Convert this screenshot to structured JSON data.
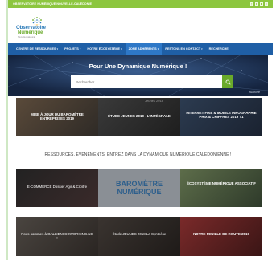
{
  "topbar": {
    "brand": "OBSERVATOIRE NUMÉRIQUE NOUVELLE-CALÉDONIE",
    "social": [
      "facebook-icon",
      "twitter-icon",
      "linkedin-icon",
      "youtube-icon"
    ]
  },
  "logo": {
    "line1": "Observatoire",
    "line2": "Numérique",
    "line3": "Nouvelle-Calédonie"
  },
  "nav": [
    {
      "label": "CENTRE DE RESSOURCES",
      "caret": true
    },
    {
      "label": "PROJETS",
      "caret": true
    },
    {
      "label": "NOTRE ÉCOSYSTÈME",
      "caret": true
    },
    {
      "label": "ZONE ADHÉRENTS",
      "caret": true,
      "active": true
    },
    {
      "label": "RESTONS EN CONTACT",
      "caret": true
    },
    {
      "label": "RECHERCHE",
      "caret": false
    }
  ],
  "hero": {
    "title": "Pour Une Dynamique Numérique !",
    "search_placeholder": "Rechercher",
    "advanced": "Avancée"
  },
  "row1": [
    {
      "label": "MISE À JOUR DU BAROMÈTRE ENTREPRISES 2019"
    },
    {
      "label": "ÉTUDE JEUNES 2018 - L'INTÉGRALE"
    },
    {
      "label": "INTERNET FIXE & MOBILE INFOGRAPHIE PRIX & CHIFFRES 2019 T1"
    }
  ],
  "row1_caption": "Jeunes 2018",
  "section_title": "RESSOURCES, ÉVÉNEMENTS, ENTREZ DANS LA DYNAMIQUE NUMÉRIQUE CALÉDONIENNE !",
  "row2": [
    {
      "label": "E-COMMERCE Dossier Agir & Croître"
    },
    {
      "label": "BAROMÈTRE NUMÉRIQUE"
    },
    {
      "label": "ÉCOSYSTÈME NUMÉRIQUE ASSOCIATIF"
    }
  ],
  "row3": [
    {
      "label": "Nous sommes à GALLIENI COWORKING.NC !"
    },
    {
      "label": "Étude JEUNES 2018 La Synthèse"
    },
    {
      "label": "NOTRE FEUILLE DE ROUTE 2019"
    }
  ],
  "colors": {
    "topbar": "#8cc63f",
    "nav": "#1f5fa6",
    "accent_green": "#6aaa2a",
    "hero_bg": "#1c2f52"
  }
}
